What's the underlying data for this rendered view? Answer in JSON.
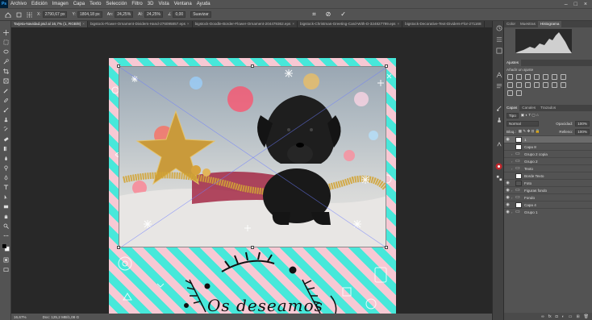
{
  "menubar": {
    "logo": "Ps",
    "items": [
      "Archivo",
      "Edición",
      "Imagen",
      "Capa",
      "Texto",
      "Selección",
      "Filtro",
      "3D",
      "Vista",
      "Ventana",
      "Ayuda"
    ],
    "window_controls": [
      "–",
      "□",
      "×"
    ]
  },
  "options": {
    "x_label": "X:",
    "x_value": "2790,67 px",
    "y_label": "Y:",
    "y_value": "1804,18 px",
    "w_label": "An:",
    "w_value": "24,25%",
    "h_label": "Al:",
    "h_value": "24,25%",
    "angle_value": "0,00",
    "interp_value": "Suavizar"
  },
  "tabs": [
    {
      "label": "Tarjeta-Navidad.psd al 16,7% (1, RGB/8)",
      "active": true
    },
    {
      "label": "bigstock-Flower-Ornament-Dividers-Hand-276095857.eps",
      "active": false
    },
    {
      "label": "bigstock-Doodle-Border-Flower-Ornament-204479362.eps",
      "active": false
    },
    {
      "label": "bigstock-Christmas-Greeting-Card-With-D-324827799.eps",
      "active": false
    },
    {
      "label": "bigstock-Decorative-Text-Dividers-Flor-271168",
      "active": false
    }
  ],
  "status": {
    "zoom": "16,67%",
    "doc": "Doc: 125,2 MB/1,08 G"
  },
  "canvas": {
    "greeting_text": "Os deseamos",
    "stripe_colors": [
      "#f7c9d4",
      "#47e8da"
    ]
  },
  "panels": {
    "top_tabs": [
      "Color",
      "Muestras",
      "Histograma"
    ],
    "top_active": "Histograma",
    "adj_tabs": [
      "Ajustes"
    ],
    "adj_subtitle": "Añadir un ajuste",
    "layer_tabs": [
      "Capas",
      "Canales",
      "Trazados"
    ],
    "layers_kind": "Tipo",
    "blend_mode": "Normal",
    "opacity_label": "Opacidad:",
    "opacity_value": "100%",
    "lock_label": "Bloq.:",
    "fill_label": "Relleno:",
    "fill_value": "100%"
  },
  "layers": [
    {
      "name": "1",
      "type": "pixel",
      "visible": true,
      "active": true
    },
    {
      "name": "Capa 8",
      "type": "pixel",
      "visible": false,
      "active": false
    },
    {
      "name": "Grupo 2 copia",
      "type": "group",
      "visible": false,
      "active": false
    },
    {
      "name": "Grupo 2",
      "type": "group",
      "visible": false,
      "active": false
    },
    {
      "name": "Texto",
      "type": "group",
      "visible": false,
      "active": false
    },
    {
      "name": "Borde Texto",
      "type": "pixel",
      "visible": false,
      "active": false
    },
    {
      "name": "Foto",
      "type": "pixel",
      "visible": true,
      "active": false
    },
    {
      "name": "Figuras fondo",
      "type": "group",
      "visible": true,
      "active": false
    },
    {
      "name": "Fondo",
      "type": "group",
      "visible": true,
      "active": false
    },
    {
      "name": "Capa 4",
      "type": "pixel",
      "visible": true,
      "active": false
    },
    {
      "name": "Grupo 1",
      "type": "group",
      "visible": true,
      "active": false
    }
  ],
  "colors": {
    "ui_dark": "#282828",
    "ui_panel": "#535353",
    "accent_pink": "#f7c9d4",
    "accent_teal": "#47e8da"
  }
}
